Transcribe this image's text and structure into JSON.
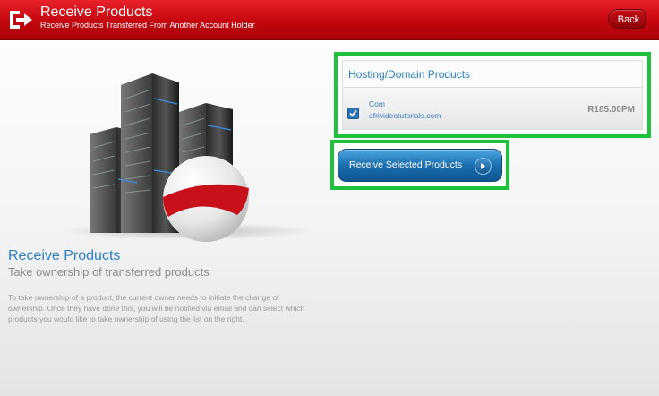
{
  "header": {
    "title": "Receive Products",
    "subtitle": "Receive Products Transferred From Another Account Holder",
    "back_label": "Back",
    "icon": "exit-arrow-icon",
    "bg_color": "#c4060e"
  },
  "left": {
    "title": "Receive Products",
    "subtitle": "Take ownership of transferred products",
    "body": "To take ownership of a product, the current owner needs to initiate the change of ownership. Once they have done this, you will be notified via email and can select which products you would like to take ownership of using the list on the right.",
    "illustration": "server-tower-illustration"
  },
  "products_panel": {
    "title": "Hosting/Domain Products",
    "items": [
      {
        "checked": true,
        "type": "Com",
        "domain": "afrivideotutorials.com",
        "price": "R185.00PM"
      }
    ]
  },
  "receive_button": {
    "label": "Receive Selected Products",
    "icon": "arrow-right-icon",
    "color": "#1b6fae"
  },
  "highlight_color": "#1ec23c"
}
